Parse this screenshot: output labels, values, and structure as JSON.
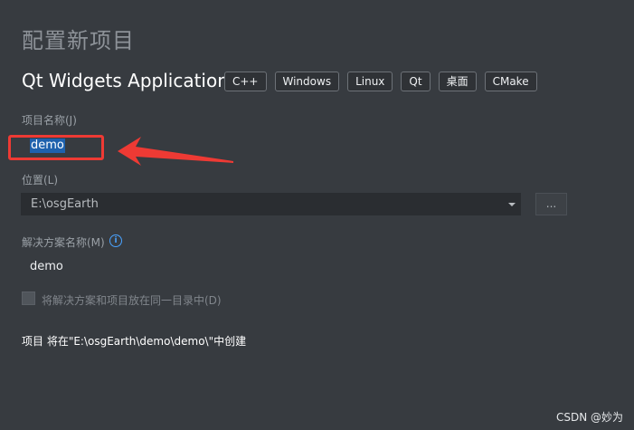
{
  "header": {
    "dialog_title": "配置新项目",
    "app_title": "Qt Widgets Application",
    "tags": [
      "C++",
      "Windows",
      "Linux",
      "Qt",
      "桌面",
      "CMake"
    ]
  },
  "form": {
    "project_name_label": "项目名称(J)",
    "project_name_value": "demo",
    "location_label": "位置(L)",
    "location_value": "E:\\osgEarth",
    "browse_label": "...",
    "solution_name_label": "解决方案名称(M)",
    "solution_name_value": "demo",
    "same_dir_checkbox_label": "将解决方案和项目放在同一目录中(D)",
    "same_dir_checked": false,
    "create_path_text": "项目 将在\"E:\\osgEarth\\demo\\demo\\\"中创建"
  },
  "annotation": {
    "highlight_color": "#ee3a34"
  },
  "watermark": "CSDN @妙为",
  "colors": {
    "background": "#373b40",
    "selection": "#1e61ad",
    "info": "#4aa3ff"
  }
}
